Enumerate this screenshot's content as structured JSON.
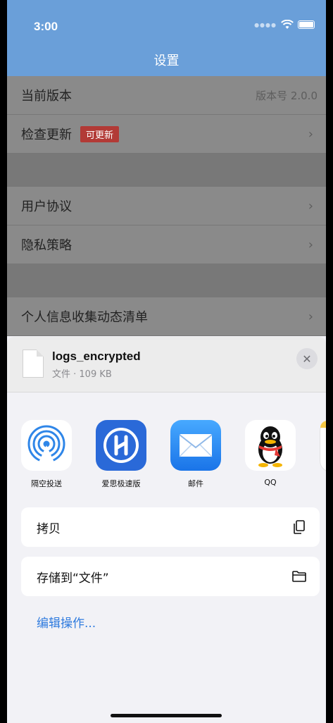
{
  "status_bar": {
    "time": "3:00"
  },
  "nav": {
    "title": "设置"
  },
  "settings": {
    "current_version_label": "当前版本",
    "current_version_value": "版本号 2.0.0",
    "check_update_label": "检查更新",
    "update_badge": "可更新",
    "user_agreement": "用户协议",
    "privacy_policy": "隐私策略",
    "personal_info_list": "个人信息收集动态清单"
  },
  "share_sheet": {
    "file_name": "logs_encrypted",
    "file_meta": "文件 · 109 KB",
    "apps": [
      {
        "label": "隔空投送",
        "icon": "airdrop-icon"
      },
      {
        "label": "爱思极速版",
        "icon": "aisi-icon"
      },
      {
        "label": "邮件",
        "icon": "mail-icon"
      },
      {
        "label": "QQ",
        "icon": "qq-icon"
      }
    ],
    "actions": [
      {
        "label": "拷贝",
        "icon": "copy-icon"
      },
      {
        "label": "存储到“文件”",
        "icon": "folder-icon"
      }
    ],
    "edit_actions": "编辑操作..."
  },
  "colors": {
    "nav_blue": "#6a9fd9",
    "badge_red": "#b23a36",
    "link_blue": "#2f7bde"
  }
}
